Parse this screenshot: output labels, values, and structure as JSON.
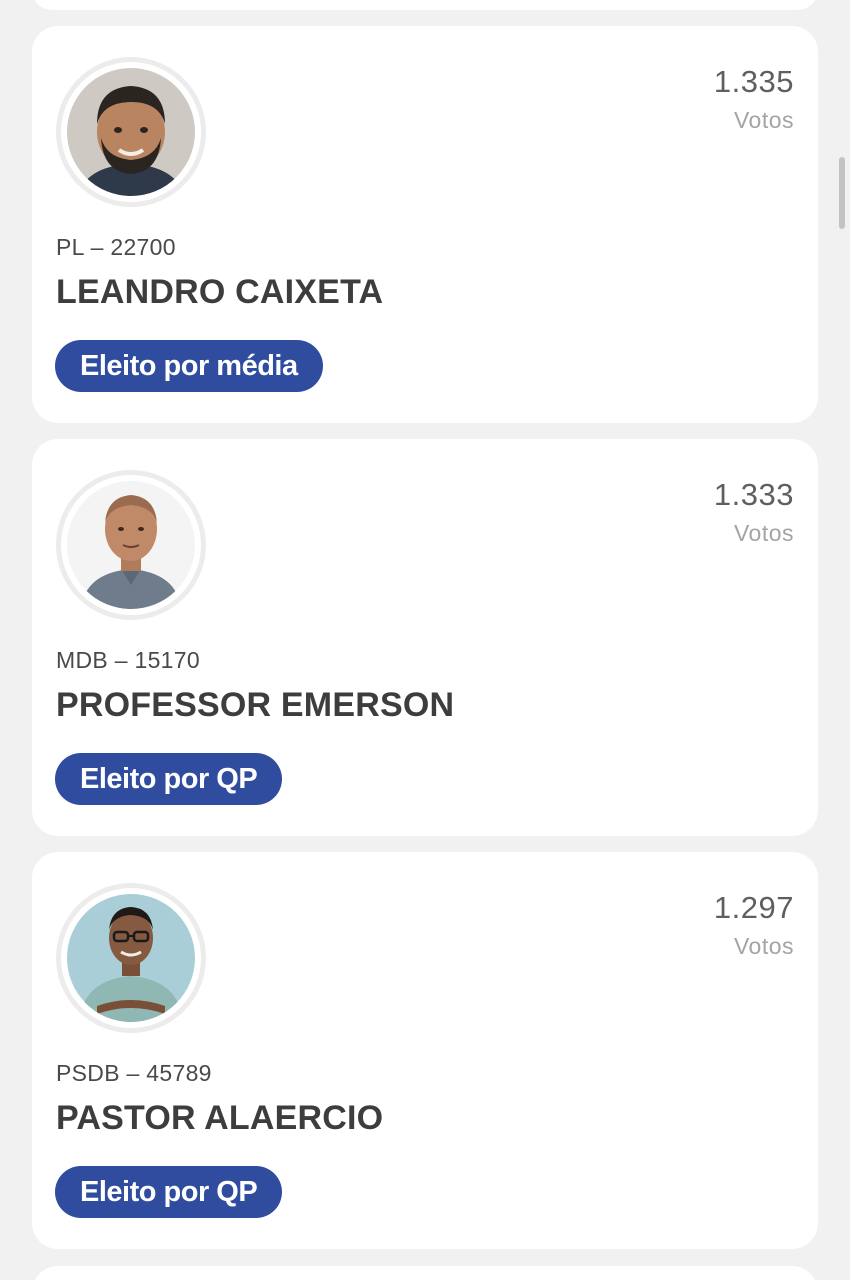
{
  "candidates": [
    {
      "party_number": "PL – 22700",
      "name": "LEANDRO CAIXETA",
      "votes": "1.335",
      "votes_label": "Votos",
      "status": "Eleito por média"
    },
    {
      "party_number": "MDB – 15170",
      "name": "PROFESSOR EMERSON",
      "votes": "1.333",
      "votes_label": "Votos",
      "status": "Eleito por QP"
    },
    {
      "party_number": "PSDB – 45789",
      "name": "PASTOR ALAERCIO",
      "votes": "1.297",
      "votes_label": "Votos",
      "status": "Eleito por QP"
    }
  ],
  "colors": {
    "badge_background": "#2f4c9f",
    "page_background": "#f1f1f1",
    "card_background": "#ffffff"
  }
}
